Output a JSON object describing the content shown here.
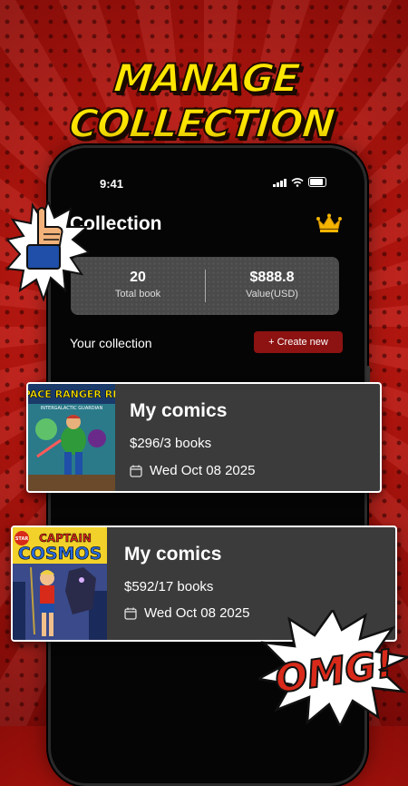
{
  "promo": {
    "headline": "MANAGE COLLECTION"
  },
  "status_bar": {
    "time": "9:41"
  },
  "header": {
    "title": "Collection"
  },
  "stats": {
    "total_books": {
      "value": "20",
      "label": "Total book"
    },
    "value_usd": {
      "value": "$888.8",
      "label": "Value(USD)"
    }
  },
  "section": {
    "title": "Your collection",
    "create_label": "+ Create new"
  },
  "collections": [
    {
      "title": "My comics",
      "price_books": "$296/3 books",
      "date": "Wed Oct 08 2025",
      "cover_text": "SPACE RANGER REX",
      "cover_sub": "INTERGALACTIC GUARDIAN"
    },
    {
      "title": "My comics",
      "price_books": "$592/17 books",
      "date": "Wed Oct 08 2025",
      "cover_text_1": "CAPTAIN",
      "cover_text_2": "COSMOS",
      "cover_badge": "STAR"
    }
  ],
  "decor": {
    "omg_text": "OMG!"
  },
  "colors": {
    "accent": "#8d1212",
    "background": "#c41a12",
    "headline": "#ffe600",
    "crown": "#f5b400"
  }
}
